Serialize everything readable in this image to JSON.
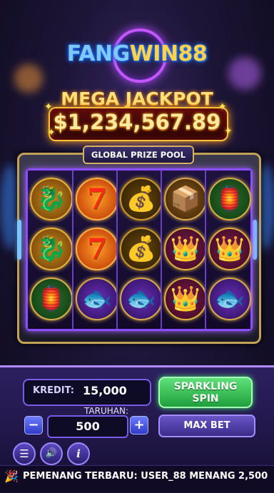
{
  "logo": {
    "part1": "FANG",
    "part2": "WIN88"
  },
  "jackpot": {
    "title": "MEGA JACKPOT",
    "amount": "$1,234,567.89"
  },
  "prize_pool": {
    "label": "GLOBAL PRIZE POOL"
  },
  "reels": [
    [
      "dragon",
      "dragon",
      "lantern"
    ],
    [
      "seven",
      "seven",
      "koi"
    ],
    [
      "gold-bag",
      "gold-bag",
      "koi"
    ],
    [
      "treasure-chest",
      "crown",
      "crown"
    ],
    [
      "lantern",
      "crown",
      "koi"
    ]
  ],
  "controls": {
    "kredit_label": "KREDIT:",
    "kredit_value": "15,000",
    "spin_label_line1": "SPARKLING",
    "spin_label_line2": "SPIN",
    "taruhan_label": "TARUHAN:",
    "bet_value": "500",
    "minus_label": "−",
    "plus_label": "+",
    "maxbet_label": "MAX BET",
    "menu_icon": "☰",
    "sound_icon": "🔊",
    "info_icon": "i"
  },
  "ticker": {
    "text": "PEMENANG TERBARU: USER_88 MENANG 2,500"
  },
  "colors": {
    "accent_gold": "#f6c33a",
    "reel_border": "#8c4dff",
    "spin_green": "#20a03c"
  }
}
